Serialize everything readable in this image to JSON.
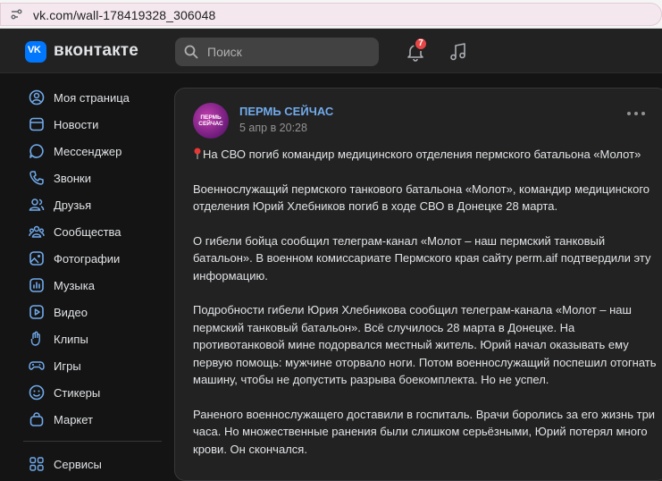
{
  "browser": {
    "url": "vk.com/wall-178419328_306048"
  },
  "header": {
    "logo_text": "вконтакте",
    "search_placeholder": "Поиск",
    "notifications_count": "7"
  },
  "sidebar": {
    "items": [
      {
        "label": "Моя страница",
        "icon": "user-icon"
      },
      {
        "label": "Новости",
        "icon": "news-icon"
      },
      {
        "label": "Мессенджер",
        "icon": "message-icon"
      },
      {
        "label": "Звонки",
        "icon": "phone-icon"
      },
      {
        "label": "Друзья",
        "icon": "friends-icon"
      },
      {
        "label": "Сообщества",
        "icon": "communities-icon"
      },
      {
        "label": "Фотографии",
        "icon": "photo-icon"
      },
      {
        "label": "Музыка",
        "icon": "music-bars-icon"
      },
      {
        "label": "Видео",
        "icon": "video-icon"
      },
      {
        "label": "Клипы",
        "icon": "clips-icon"
      },
      {
        "label": "Игры",
        "icon": "gamepad-icon"
      },
      {
        "label": "Стикеры",
        "icon": "smile-icon"
      },
      {
        "label": "Маркет",
        "icon": "market-icon"
      }
    ],
    "services_label": "Сервисы"
  },
  "post": {
    "author": "ПЕРМЬ СЕЙЧАС",
    "avatar_text": "ПЕРМЬ СЕЙЧАС",
    "date": "5 апр в 20:28",
    "title": "На СВО погиб командир медицинского отделения пермского батальона «Молот»",
    "paragraphs": [
      "Военнослужащий пермского танкового батальона «Молот», командир медицинского отделения Юрий Хлебников погиб в ходе СВО в Донецке 28 марта.",
      "О гибели бойца сообщил телеграм-канал «Молот – наш пермский танковый батальон». В военном комиссариате Пермского края сайту perm.aif подтвердили эту информацию.",
      "Подробности гибели Юрия Хлебникова сообщил телеграм-канала «Молот – наш пермский танковый батальон». Всё случилось 28 марта в Донецке. На противотанковой мине подорвался местный житель. Юрий начал оказывать ему первую помощь: мужчине оторвало ноги. Потом военнослужащий поспешил отогнать машину, чтобы не допустить разрыва боекомплекта. Но не успел.",
      "Раненого военнослужащего доставили в госпиталь. Врачи боролись за его жизнь три часа. Но множественные ранения были слишком серьёзными, Юрий потерял много крови. Он скончался."
    ]
  },
  "colors": {
    "accent": "#71aaeb",
    "badge": "#e64646",
    "brand": "#0077ff"
  }
}
